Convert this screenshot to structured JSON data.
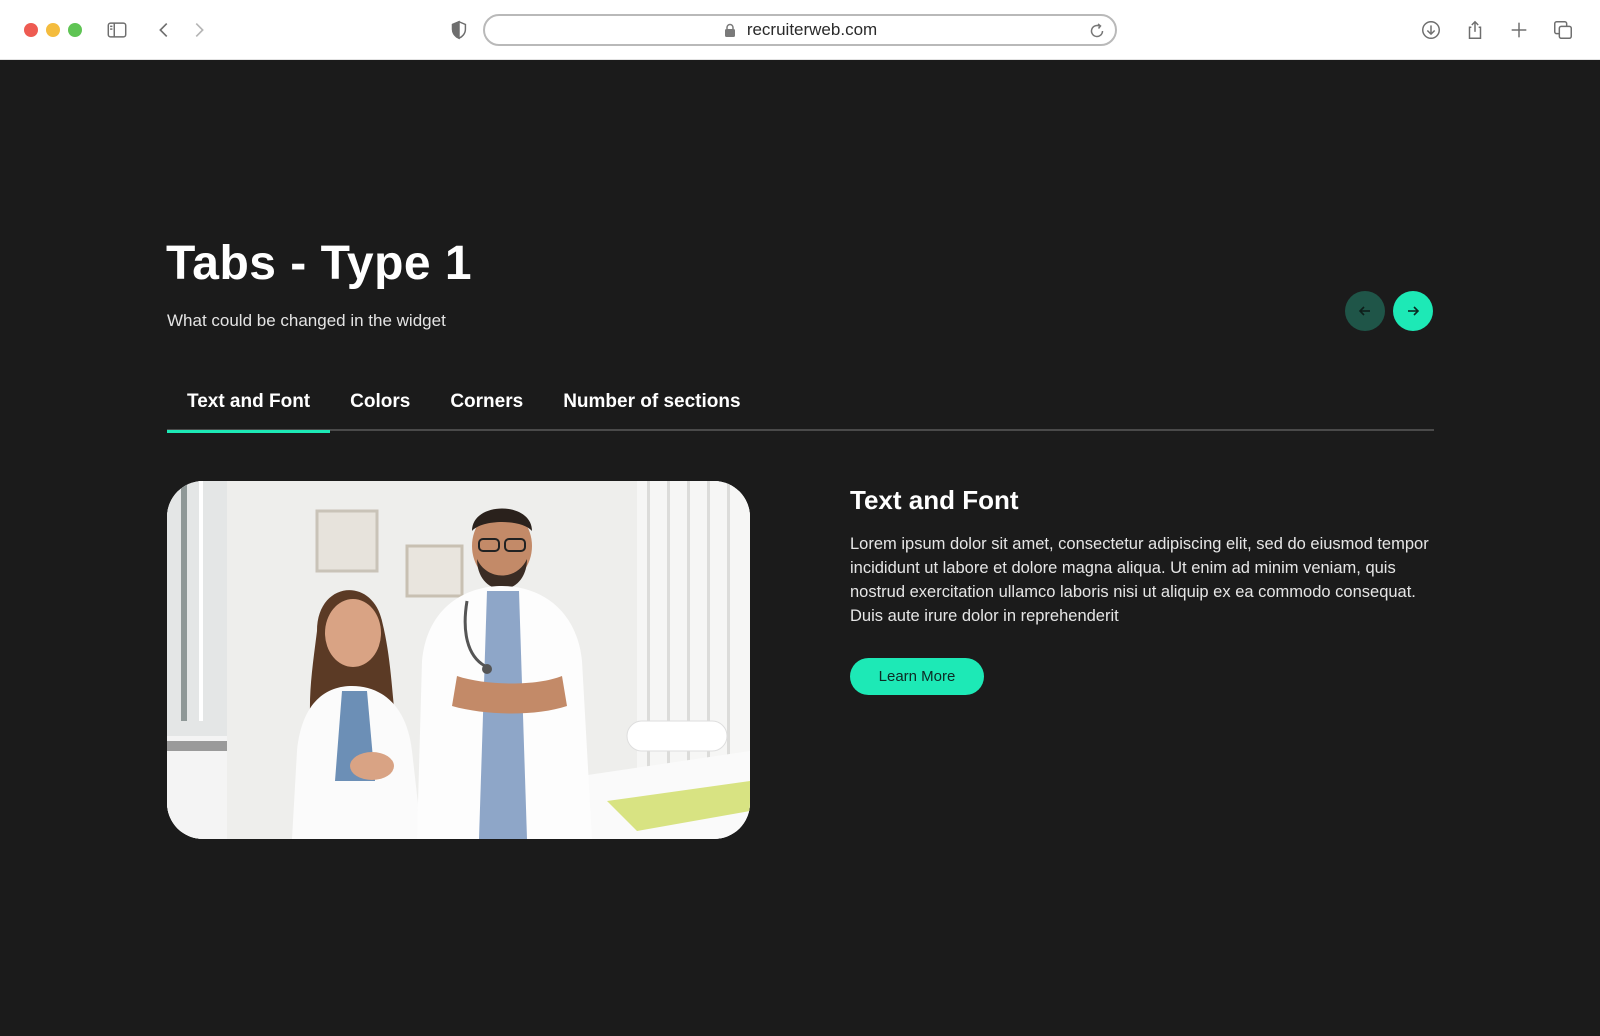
{
  "browser": {
    "url": "recruiterweb.com"
  },
  "header": {
    "title": "Tabs - Type 1",
    "subtitle": "What could be changed in the widget"
  },
  "tabs": [
    {
      "label": "Text and Font",
      "active": true
    },
    {
      "label": "Colors",
      "active": false
    },
    {
      "label": "Corners",
      "active": false
    },
    {
      "label": "Number of sections",
      "active": false
    }
  ],
  "content": {
    "title": "Text and Font",
    "body": "Lorem ipsum dolor sit amet, consectetur adipiscing elit, sed do eiusmod tempor incididunt ut labore et dolore magna aliqua. Ut enim ad minim veniam, quis nostrud exercitation ullamco laboris nisi ut aliquip ex ea commodo consequat. Duis aute irure dolor in reprehenderit",
    "button_label": "Learn More"
  },
  "colors": {
    "background": "#1b1b1b",
    "accent": "#1de9b6",
    "accent_dark": "#1f5548"
  },
  "icons": {
    "sidebar": "sidebar-icon",
    "back": "chevron-left-icon",
    "forward": "chevron-right-icon",
    "privacy": "shield-icon",
    "lock": "lock-icon",
    "reload": "reload-icon",
    "download": "download-icon",
    "share": "share-icon",
    "new_tab": "plus-icon",
    "tabs_overview": "tabs-icon",
    "prev_slide": "arrow-left-icon",
    "next_slide": "arrow-right-icon"
  }
}
